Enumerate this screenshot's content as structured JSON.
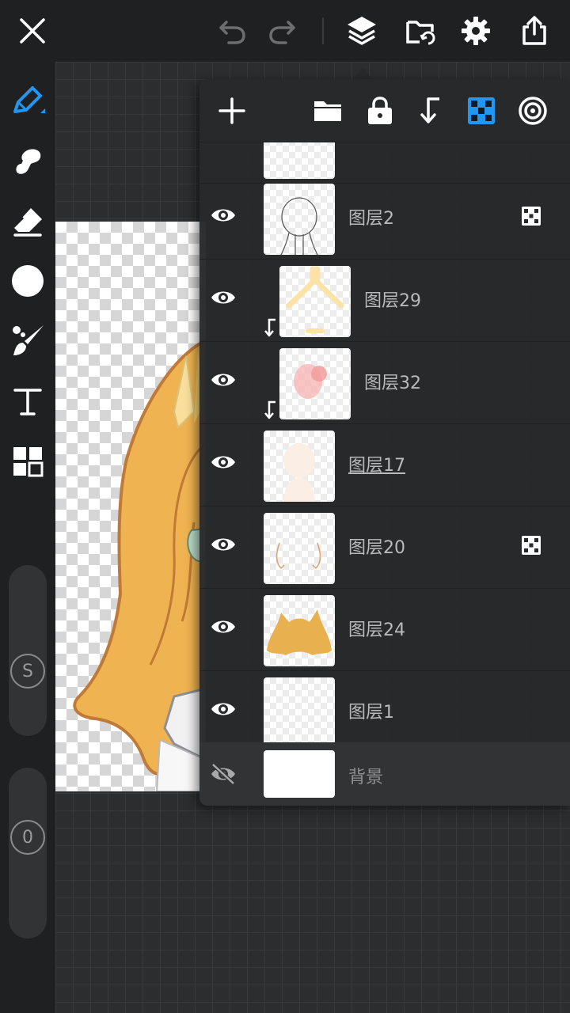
{
  "top_toolbar": {
    "icons": [
      "close-icon",
      "undo-icon",
      "redo-icon",
      "layers-icon",
      "folder-sync-icon",
      "settings-gear-icon",
      "share-export-icon"
    ]
  },
  "left_toolbar": {
    "icons": [
      "pen-icon",
      "smudge-icon",
      "eraser-icon",
      "fill-circle-icon",
      "brush-icon",
      "text-icon",
      "grid-icon"
    ],
    "size_label": "S",
    "opacity_label": "0",
    "accent_color": "#2196f3"
  },
  "layer_panel": {
    "toolbar_icons": [
      "add-icon",
      "folder-icon",
      "lock-icon",
      "merge-down-icon",
      "alpha-lock-icon",
      "blend-target-icon"
    ],
    "layers": [
      {
        "name": "图层2",
        "visible": true,
        "alpha_lock": true,
        "clipped": false,
        "underlined": false
      },
      {
        "name": "图层29",
        "visible": true,
        "alpha_lock": false,
        "clipped": true,
        "underlined": false
      },
      {
        "name": "图层32",
        "visible": true,
        "alpha_lock": false,
        "clipped": true,
        "underlined": false
      },
      {
        "name": "图层17",
        "visible": true,
        "alpha_lock": false,
        "clipped": false,
        "underlined": true
      },
      {
        "name": "图层20",
        "visible": true,
        "alpha_lock": true,
        "clipped": false,
        "underlined": false
      },
      {
        "name": "图层24",
        "visible": true,
        "alpha_lock": false,
        "clipped": false,
        "underlined": false
      },
      {
        "name": "图层1",
        "visible": true,
        "alpha_lock": false,
        "clipped": false,
        "underlined": false
      },
      {
        "name": "背景",
        "visible": false,
        "alpha_lock": false,
        "clipped": false,
        "underlined": false
      }
    ]
  },
  "colors": {
    "panel_bg": "#28292a",
    "toolbar_bg": "#1f2021",
    "icon_white": "#ffffff",
    "icon_disabled": "#6d6e6f",
    "accent_blue": "#2196f3",
    "hair_orange": "#efb451"
  }
}
